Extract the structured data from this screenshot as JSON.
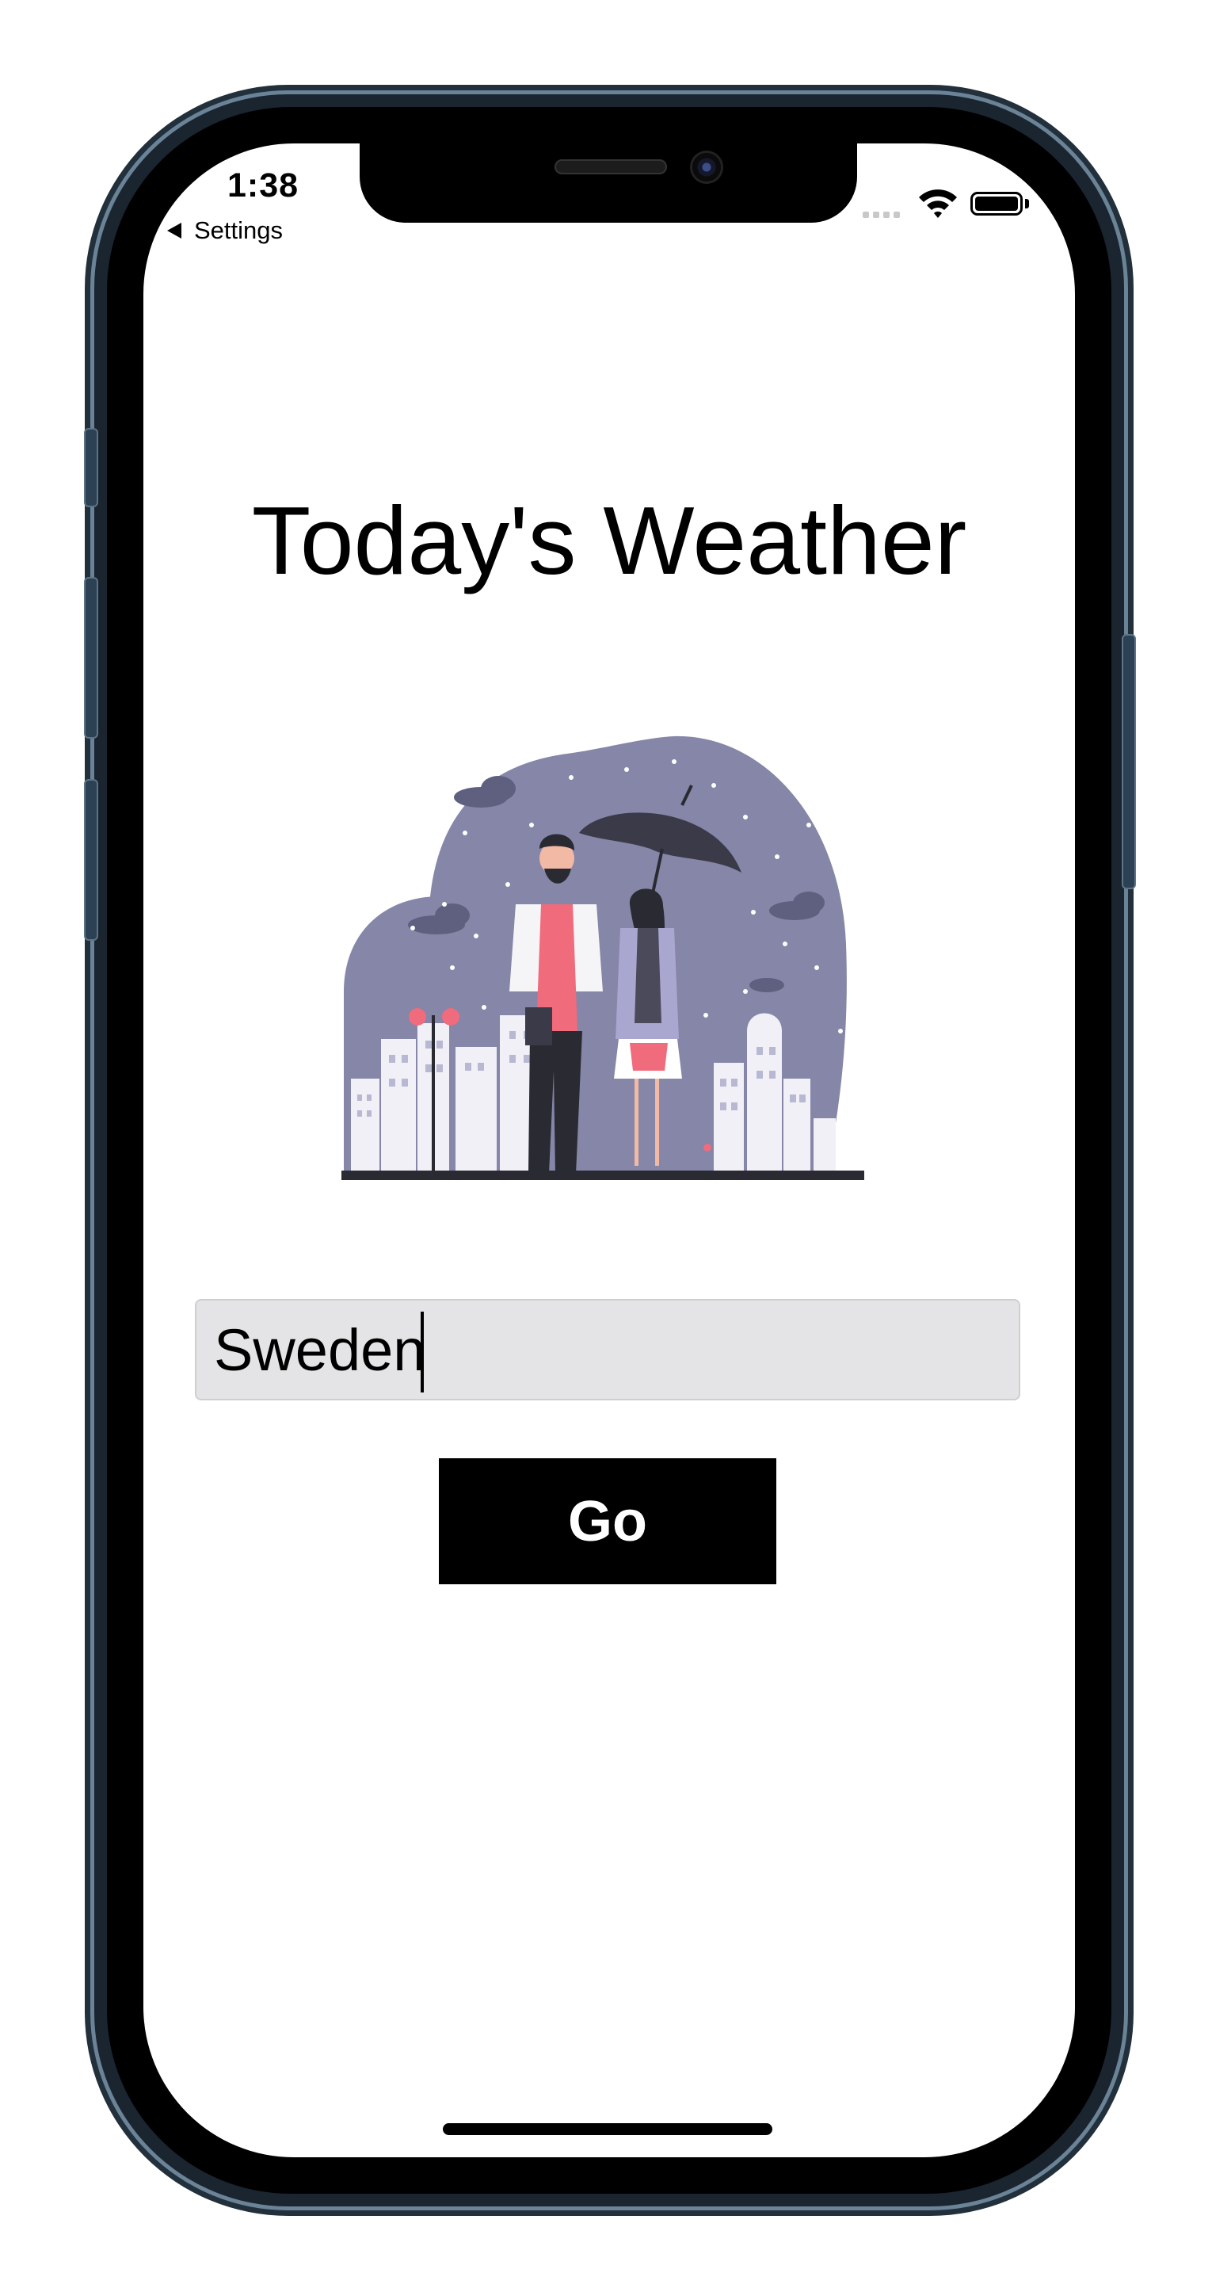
{
  "status_bar": {
    "time": "1:38",
    "back_label": "Settings"
  },
  "main": {
    "title": "Today's Weather",
    "search": {
      "value": "Sweden",
      "placeholder": ""
    },
    "go_label": "Go"
  },
  "colors": {
    "illustration_bg": "#8586a8",
    "accent_pink": "#f06b7c",
    "button_bg": "#000000",
    "input_bg": "#e4e4e6"
  },
  "icons": {
    "back": "chevron-left-icon",
    "wifi": "wifi-icon",
    "battery": "battery-icon",
    "signal": "signal-icon"
  }
}
